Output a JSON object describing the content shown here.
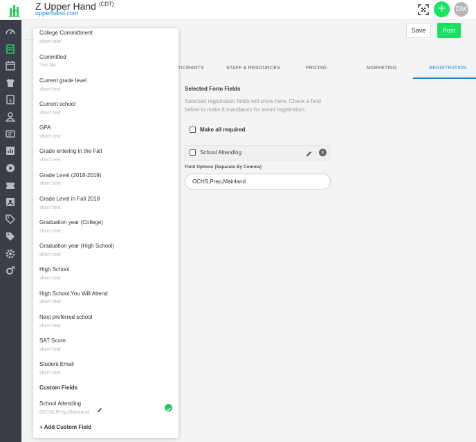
{
  "header": {
    "title": "Z Upper Hand",
    "timezone": "(CDT)",
    "subtitle": "upperhand.com",
    "avatar_initials": "DM",
    "add_label": "+",
    "icons": [
      "logo-icon",
      "qr-scan-icon",
      "add-icon"
    ]
  },
  "sidebar": {
    "icons": [
      "dashboard-icon",
      "events-icon",
      "calendar-icon",
      "apparel-icon",
      "membership-icon",
      "customers-icon",
      "messages-icon",
      "reports-icon",
      "credit-pass-icon",
      "tickets-icon",
      "team-icon",
      "tag-icon",
      "discount-icon",
      "settings-icon",
      "integrations-icon"
    ]
  },
  "actions": {
    "save_label": "Save",
    "post_label": "Post"
  },
  "tabs": [
    {
      "label": "TICIPANTS"
    },
    {
      "label": "STAFF & RESOURCES"
    },
    {
      "label": "PRICING"
    },
    {
      "label": "MARKETING"
    },
    {
      "label": "REGISTRATION",
      "active": true
    }
  ],
  "registration": {
    "section_title": "Selected Form Fields",
    "help_text": "Selected registration fields will show here. Check a field below to make it mandatory for event registration.",
    "make_all_required": "Make all required",
    "selected_field": "School Attending",
    "field_options_label": "Field Options (Separate By Comma)",
    "field_options_value": "OCHS,Prep,Mainland"
  },
  "dropdown": {
    "items": [
      {
        "name": "College Committment",
        "type": "short text"
      },
      {
        "name": "Committed",
        "type": "Yes,No"
      },
      {
        "name": "Current grade level",
        "type": "short text"
      },
      {
        "name": "Current school",
        "type": "short text"
      },
      {
        "name": "GPA",
        "type": "short text"
      },
      {
        "name": "Grade entering in the Fall",
        "type": "short text"
      },
      {
        "name": "Grade Level (2018-2019)",
        "type": "short text"
      },
      {
        "name": "Grade Level in Fall 2018",
        "type": "short text"
      },
      {
        "name": "Graduation year (College)",
        "type": "short text"
      },
      {
        "name": "Graduation year (High School)",
        "type": "short text"
      },
      {
        "name": "High School",
        "type": "short text"
      },
      {
        "name": "High School You Will Attend",
        "type": "short text"
      },
      {
        "name": "Next preferred school",
        "type": "short text"
      },
      {
        "name": "SAT Score",
        "type": "short text"
      },
      {
        "name": "Student Email",
        "type": "short text"
      }
    ],
    "custom_heading": "Custom Fields",
    "custom_items": [
      {
        "name": "School Attending",
        "type": "OCHS,Prep,Mainland",
        "selected": true
      }
    ],
    "add_custom_label": "+ Add Custom Field"
  },
  "colors": {
    "accent_green": "#19e35f",
    "accent_blue": "#1e88d8",
    "sidebar_bg": "#3b3e4a",
    "check_green": "#28c45f"
  }
}
